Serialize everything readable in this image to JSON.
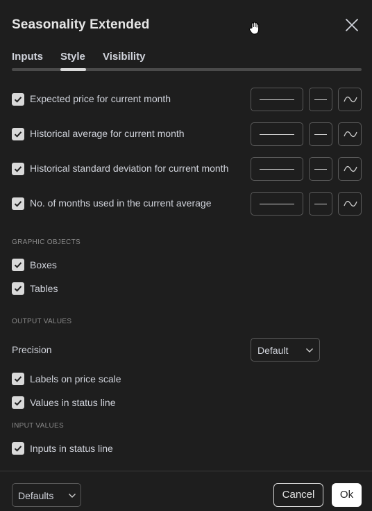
{
  "dialog": {
    "title": "Seasonality Extended",
    "tabs": [
      {
        "label": "Inputs",
        "active": false
      },
      {
        "label": "Style",
        "active": true
      },
      {
        "label": "Visibility",
        "active": false
      }
    ]
  },
  "style": {
    "plots": [
      {
        "label": "Expected price for current month",
        "checked": true
      },
      {
        "label": "Historical average for current month",
        "checked": true
      },
      {
        "label": "Historical standard deviation for current month",
        "checked": true
      },
      {
        "label": "No. of months used in the current average",
        "checked": true
      }
    ],
    "sections": {
      "graphic_objects": "GRAPHIC OBJECTS",
      "output_values": "OUTPUT VALUES",
      "input_values": "INPUT VALUES"
    },
    "graphic_objects": [
      {
        "label": "Boxes",
        "checked": true
      },
      {
        "label": "Tables",
        "checked": true
      }
    ],
    "precision": {
      "label": "Precision",
      "value": "Default"
    },
    "output_values": [
      {
        "label": "Labels on price scale",
        "checked": true
      },
      {
        "label": "Values in status line",
        "checked": true
      }
    ],
    "input_values": [
      {
        "label": "Inputs in status line",
        "checked": true
      }
    ]
  },
  "footer": {
    "defaults_label": "Defaults",
    "cancel_label": "Cancel",
    "ok_label": "Ok"
  },
  "colors": {
    "background": "#1e1e1e",
    "checkbox": "#d9d9d9",
    "ok_button": "#ffffff"
  }
}
